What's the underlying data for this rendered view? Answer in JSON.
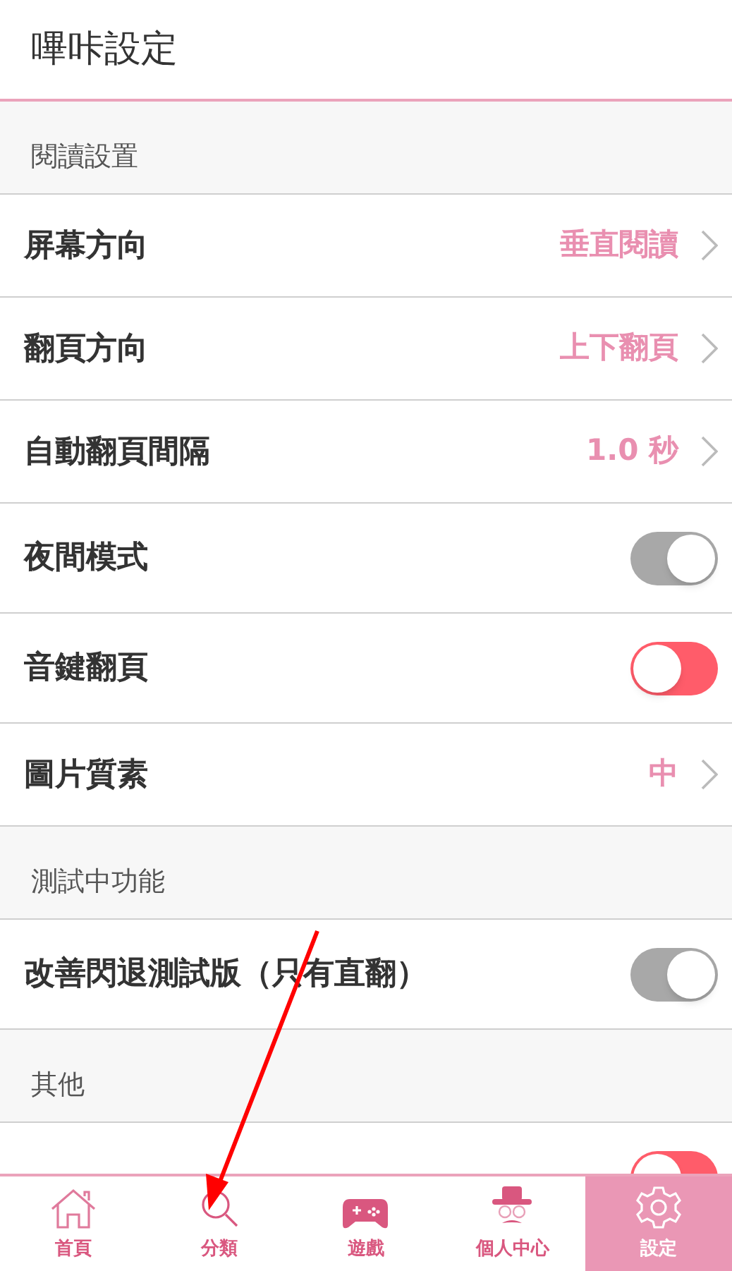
{
  "header": {
    "title": "嗶咔設定"
  },
  "sections": [
    {
      "title": "閱讀設置",
      "rows": [
        {
          "kind": "link",
          "label": "屏幕方向",
          "value": "垂直閱讀"
        },
        {
          "kind": "link",
          "label": "翻頁方向",
          "value": "上下翻頁"
        },
        {
          "kind": "link",
          "label": "自動翻頁間隔",
          "value": "1.0 秒"
        },
        {
          "kind": "toggle",
          "label": "夜間模式",
          "on": true
        },
        {
          "kind": "toggle",
          "label": "音鍵翻頁",
          "on": false
        },
        {
          "kind": "link",
          "label": "圖片質素",
          "value": "中"
        }
      ]
    },
    {
      "title": "測試中功能",
      "rows": [
        {
          "kind": "toggle",
          "label": "改善閃退測試版（只有直翻）",
          "on": true
        }
      ]
    },
    {
      "title": "其他",
      "rows": [
        {
          "kind": "toggle",
          "on": false
        }
      ]
    }
  ],
  "nav": [
    {
      "kind": "home",
      "label": "首頁",
      "selected": false
    },
    {
      "kind": "search",
      "label": "分類",
      "selected": false
    },
    {
      "kind": "game",
      "label": "遊戲",
      "selected": false
    },
    {
      "kind": "profile",
      "label": "個人中心",
      "selected": false
    },
    {
      "kind": "settings",
      "label": "設定",
      "selected": true
    }
  ]
}
